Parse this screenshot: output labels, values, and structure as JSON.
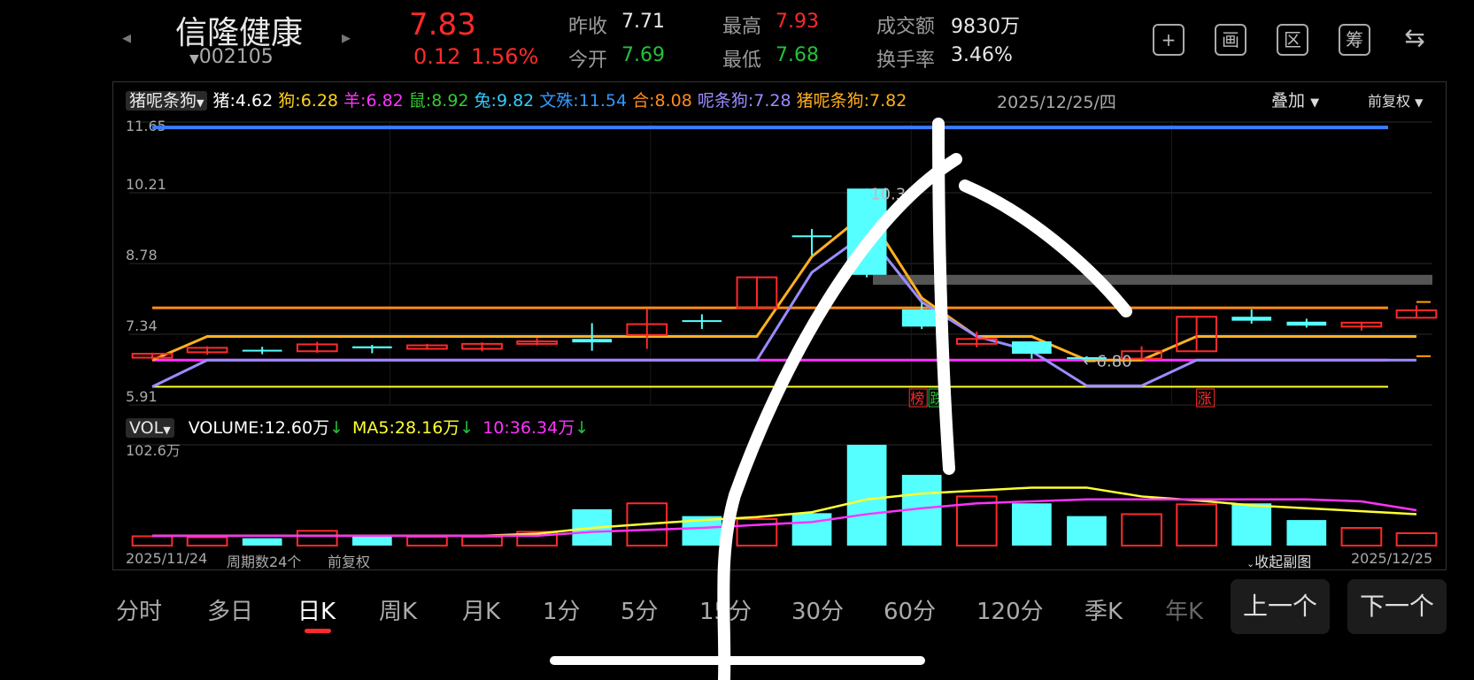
{
  "header": {
    "name": "信隆健康",
    "code": "002105",
    "price": "7.83",
    "change": "0.12",
    "change_pct": "1.56%",
    "prev_close_label": "昨收",
    "prev_close": "7.71",
    "open_label": "今开",
    "open": "7.69",
    "high_label": "最高",
    "high": "7.93",
    "low_label": "最低",
    "low": "7.68",
    "amount_label": "成交额",
    "amount": "9830万",
    "turnover_label": "换手率",
    "turnover": "3.46%",
    "buttons": [
      "+",
      "画",
      "区",
      "筹",
      "⇆"
    ]
  },
  "colors": {
    "up": "#ff2a2a",
    "down": "#55ffff",
    "bg": "#000000"
  },
  "main_chart": {
    "indicator_select": "猪呢条狗",
    "legend": [
      {
        "label": "猪:4.62",
        "color": "#ffffff"
      },
      {
        "label": "狗:6.28",
        "color": "#ffd21e"
      },
      {
        "label": "羊:6.82",
        "color": "#ff33ff"
      },
      {
        "label": "鼠:8.92",
        "color": "#33cc33"
      },
      {
        "label": "兔:9.82",
        "color": "#33ccff"
      },
      {
        "label": "文殊:11.54",
        "color": "#3399ff"
      },
      {
        "label": "合:8.08",
        "color": "#ff8c1a"
      },
      {
        "label": "呢条狗:7.28",
        "color": "#9a8cff"
      },
      {
        "label": "猪呢条狗:7.82",
        "color": "#ffb020"
      }
    ],
    "date": "2025/12/25/四",
    "overlay_label": "叠加",
    "adjust_label": "前复权",
    "y_ticks": [
      "11.65",
      "10.21",
      "8.78",
      "7.34",
      "5.91"
    ],
    "ylim": [
      5.91,
      11.65
    ],
    "max_annotation": "10.30",
    "min_annotation": "6.80",
    "badges": [
      {
        "text": "榜",
        "color": "#ff2a2a"
      },
      {
        "text": "跌",
        "color": "#25c03a"
      },
      {
        "text": "涨",
        "color": "#ff2a2a"
      }
    ]
  },
  "candles": [
    {
      "o": 6.95,
      "c": 6.87,
      "h": 6.97,
      "l": 6.83,
      "up": true
    },
    {
      "o": 6.98,
      "c": 7.07,
      "h": 7.1,
      "l": 6.93,
      "up": true
    },
    {
      "o": 7.03,
      "c": 7.0,
      "h": 7.09,
      "l": 6.94,
      "up": false
    },
    {
      "o": 7.0,
      "c": 7.14,
      "h": 7.19,
      "l": 6.97,
      "up": true
    },
    {
      "o": 7.1,
      "c": 7.06,
      "h": 7.13,
      "l": 6.96,
      "up": false
    },
    {
      "o": 7.05,
      "c": 7.12,
      "h": 7.15,
      "l": 7.03,
      "up": true
    },
    {
      "o": 7.05,
      "c": 7.15,
      "h": 7.18,
      "l": 7.0,
      "up": true
    },
    {
      "o": 7.15,
      "c": 7.2,
      "h": 7.27,
      "l": 7.12,
      "up": true
    },
    {
      "o": 7.18,
      "c": 7.25,
      "h": 7.57,
      "l": 7.01,
      "up": false
    },
    {
      "o": 7.33,
      "c": 7.55,
      "h": 7.85,
      "l": 7.05,
      "up": true
    },
    {
      "o": 7.6,
      "c": 7.63,
      "h": 7.75,
      "l": 7.45,
      "up": false
    },
    {
      "o": 7.88,
      "c": 8.5,
      "h": 8.52,
      "l": 7.86,
      "up": true
    },
    {
      "o": 9.35,
      "c": 9.35,
      "h": 9.48,
      "l": 8.95,
      "up": false
    },
    {
      "o": 10.3,
      "c": 8.55,
      "h": 10.3,
      "l": 8.5,
      "up": false
    },
    {
      "o": 7.85,
      "c": 7.5,
      "h": 7.98,
      "l": 7.45,
      "up": false
    },
    {
      "o": 7.25,
      "c": 7.15,
      "h": 7.4,
      "l": 7.08,
      "up": true
    },
    {
      "o": 7.2,
      "c": 6.95,
      "h": 7.2,
      "l": 6.85,
      "up": false
    },
    {
      "o": 6.88,
      "c": 6.86,
      "h": 6.9,
      "l": 6.8,
      "up": false
    },
    {
      "o": 6.85,
      "c": 7.0,
      "h": 7.1,
      "l": 6.83,
      "up": true
    },
    {
      "o": 7.0,
      "c": 7.7,
      "h": 7.72,
      "l": 6.98,
      "up": true
    },
    {
      "o": 7.7,
      "c": 7.62,
      "h": 7.85,
      "l": 7.56,
      "up": false
    },
    {
      "o": 7.6,
      "c": 7.52,
      "h": 7.66,
      "l": 7.48,
      "up": false
    },
    {
      "o": 7.58,
      "c": 7.5,
      "h": 7.6,
      "l": 7.42,
      "up": true
    },
    {
      "o": 7.68,
      "c": 7.83,
      "h": 7.93,
      "l": 7.68,
      "up": true
    }
  ],
  "lines": {
    "orange_line": 7.88,
    "magenta_line": 6.82,
    "yellow_line": 6.28,
    "blue_line": 11.54,
    "yellow_path": [
      6.82,
      7.3,
      7.3,
      7.3,
      7.3,
      7.3,
      7.3,
      7.3,
      7.3,
      7.3,
      7.3,
      7.3,
      8.92,
      9.82,
      8.08,
      7.3,
      7.3,
      6.82,
      6.82,
      7.3,
      7.3,
      7.3,
      7.3,
      7.3
    ],
    "purple_path": [
      6.28,
      6.82,
      6.82,
      6.82,
      6.82,
      6.82,
      6.82,
      6.82,
      6.82,
      6.82,
      6.82,
      6.82,
      8.6,
      9.4,
      8.0,
      7.3,
      7.0,
      6.3,
      6.3,
      6.82,
      6.82,
      6.82,
      6.82,
      6.82
    ]
  },
  "volume_chart": {
    "select": "VOL",
    "legend": [
      {
        "label": "VOLUME:12.60万",
        "color": "#ffffff",
        "arrow": "↓"
      },
      {
        "label": "MA5:28.16万",
        "color": "#ffff33",
        "arrow": "↓"
      },
      {
        "label": "10:36.34万",
        "color": "#ff33ff",
        "arrow": "↓"
      }
    ],
    "y_max_label": "102.6万",
    "ymax": 102.6,
    "bars": [
      9.5,
      8.5,
      7.5,
      15,
      11,
      9,
      9,
      14,
      37,
      43,
      30,
      27,
      33,
      102.6,
      72,
      50,
      43,
      30,
      32,
      42,
      43,
      26,
      18,
      12.6
    ],
    "ma5": [
      10,
      10,
      10,
      10,
      10,
      10,
      10,
      12,
      18,
      22,
      26,
      29,
      34,
      47,
      53,
      56,
      59,
      59,
      50,
      46,
      41,
      38,
      35,
      32
    ],
    "ma10": [
      10,
      10,
      10,
      10,
      10,
      10,
      10,
      10,
      14,
      16,
      18,
      21,
      24,
      32,
      38,
      43,
      45,
      47,
      47,
      47,
      47,
      47,
      45,
      36
    ]
  },
  "footer": {
    "start_date": "2025/11/24",
    "period_count": "周期数24个",
    "adjust": "前复权",
    "collapse": "收起副图",
    "end_date": "2025/12/25"
  },
  "tabs": [
    "分时",
    "多日",
    "日K",
    "周K",
    "月K",
    "1分",
    "5分",
    "15分",
    "30分",
    "60分",
    "120分",
    "季K",
    "年K"
  ],
  "active_tab": "日K",
  "nav": {
    "prev": "上一个",
    "next": "下一个"
  }
}
